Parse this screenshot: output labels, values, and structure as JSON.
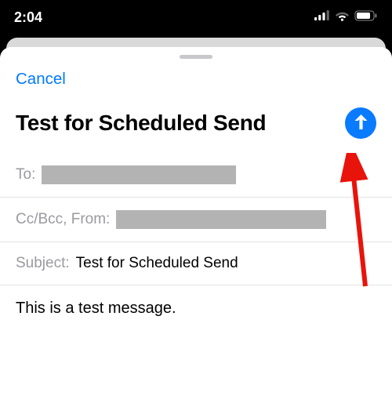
{
  "status": {
    "time": "2:04"
  },
  "compose": {
    "cancel_label": "Cancel",
    "title": "Test for Scheduled Send",
    "fields": {
      "to_label": "To:",
      "ccbcc_label": "Cc/Bcc, From:",
      "subject_label": "Subject:",
      "subject_value": "Test for Scheduled Send"
    },
    "body": "This is a test message."
  },
  "icons": {
    "send": "arrow-up-icon",
    "cellular": "cellular-icon",
    "wifi": "wifi-icon",
    "battery": "battery-icon"
  }
}
